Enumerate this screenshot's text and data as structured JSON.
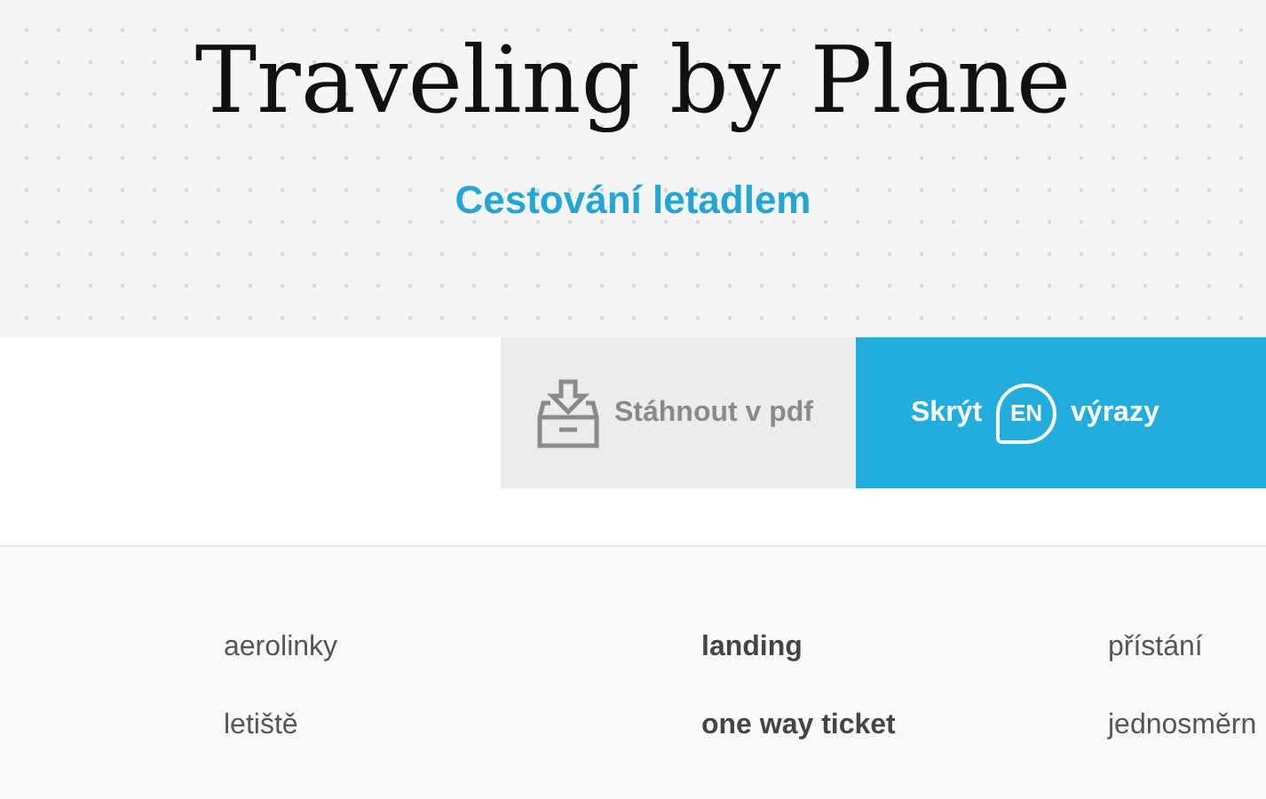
{
  "header": {
    "title": "Traveling by Plane",
    "subtitle": "Cestování letadlem"
  },
  "actions": [
    {
      "kind": "download",
      "label": "Stáhnout v pdf"
    },
    {
      "kind": "toggle",
      "label_before": "Skrýt",
      "badge": "EN",
      "label_after": "výrazy"
    }
  ],
  "vocabulary": [
    {
      "czech": "aerolinky",
      "english": "landing",
      "translation": "přístání"
    },
    {
      "czech": "letiště",
      "english": "one way ticket",
      "translation": "jednosměrn"
    }
  ]
}
